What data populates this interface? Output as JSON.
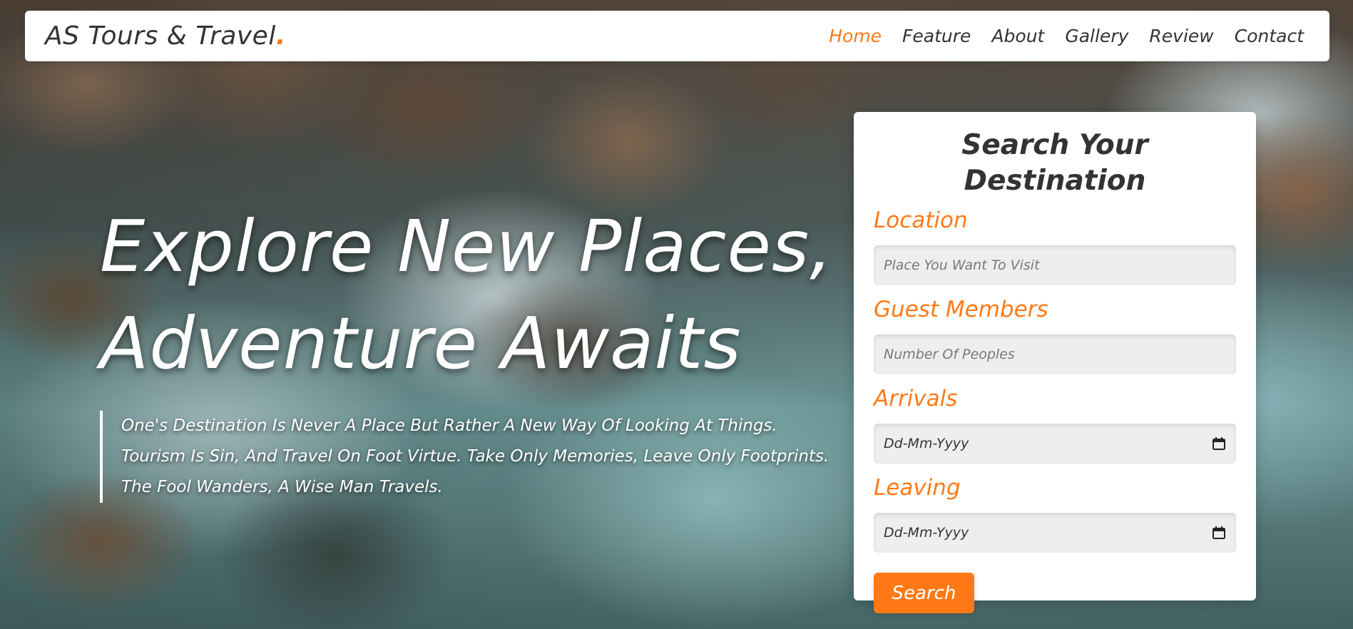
{
  "header": {
    "logo_text": "AS Tours & Travel",
    "logo_dot": ".",
    "nav": [
      {
        "label": "Home",
        "active": true
      },
      {
        "label": "Feature"
      },
      {
        "label": "About"
      },
      {
        "label": "Gallery"
      },
      {
        "label": "Review"
      },
      {
        "label": "Contact"
      }
    ]
  },
  "hero": {
    "title_line1": "Explore New Places,",
    "title_line2": "Adventure Awaits",
    "quote": "One's Destination Is Never A Place But Rather A New Way Of Looking At Things. Tourism Is Sin, And Travel On Foot Virtue. Take Only Memories, Leave Only Footprints. The Fool Wanders, A Wise Man Travels."
  },
  "search_form": {
    "title": "Search Your Destination",
    "location_label": "Location",
    "location_placeholder": "Place You Want To Visit",
    "guests_label": "Guest Members",
    "guests_placeholder": "Number Of Peoples",
    "arrivals_label": "Arrivals",
    "arrivals_value": "Dd-Mm-Yyyy",
    "leaving_label": "Leaving",
    "leaving_value": "Dd-Mm-Yyyy",
    "search_button": "Search"
  },
  "colors": {
    "accent": "#ff7a17",
    "text_dark": "#333333",
    "field_bg": "#eeeeee"
  },
  "icons": {
    "date_picker": "calendar-icon"
  }
}
